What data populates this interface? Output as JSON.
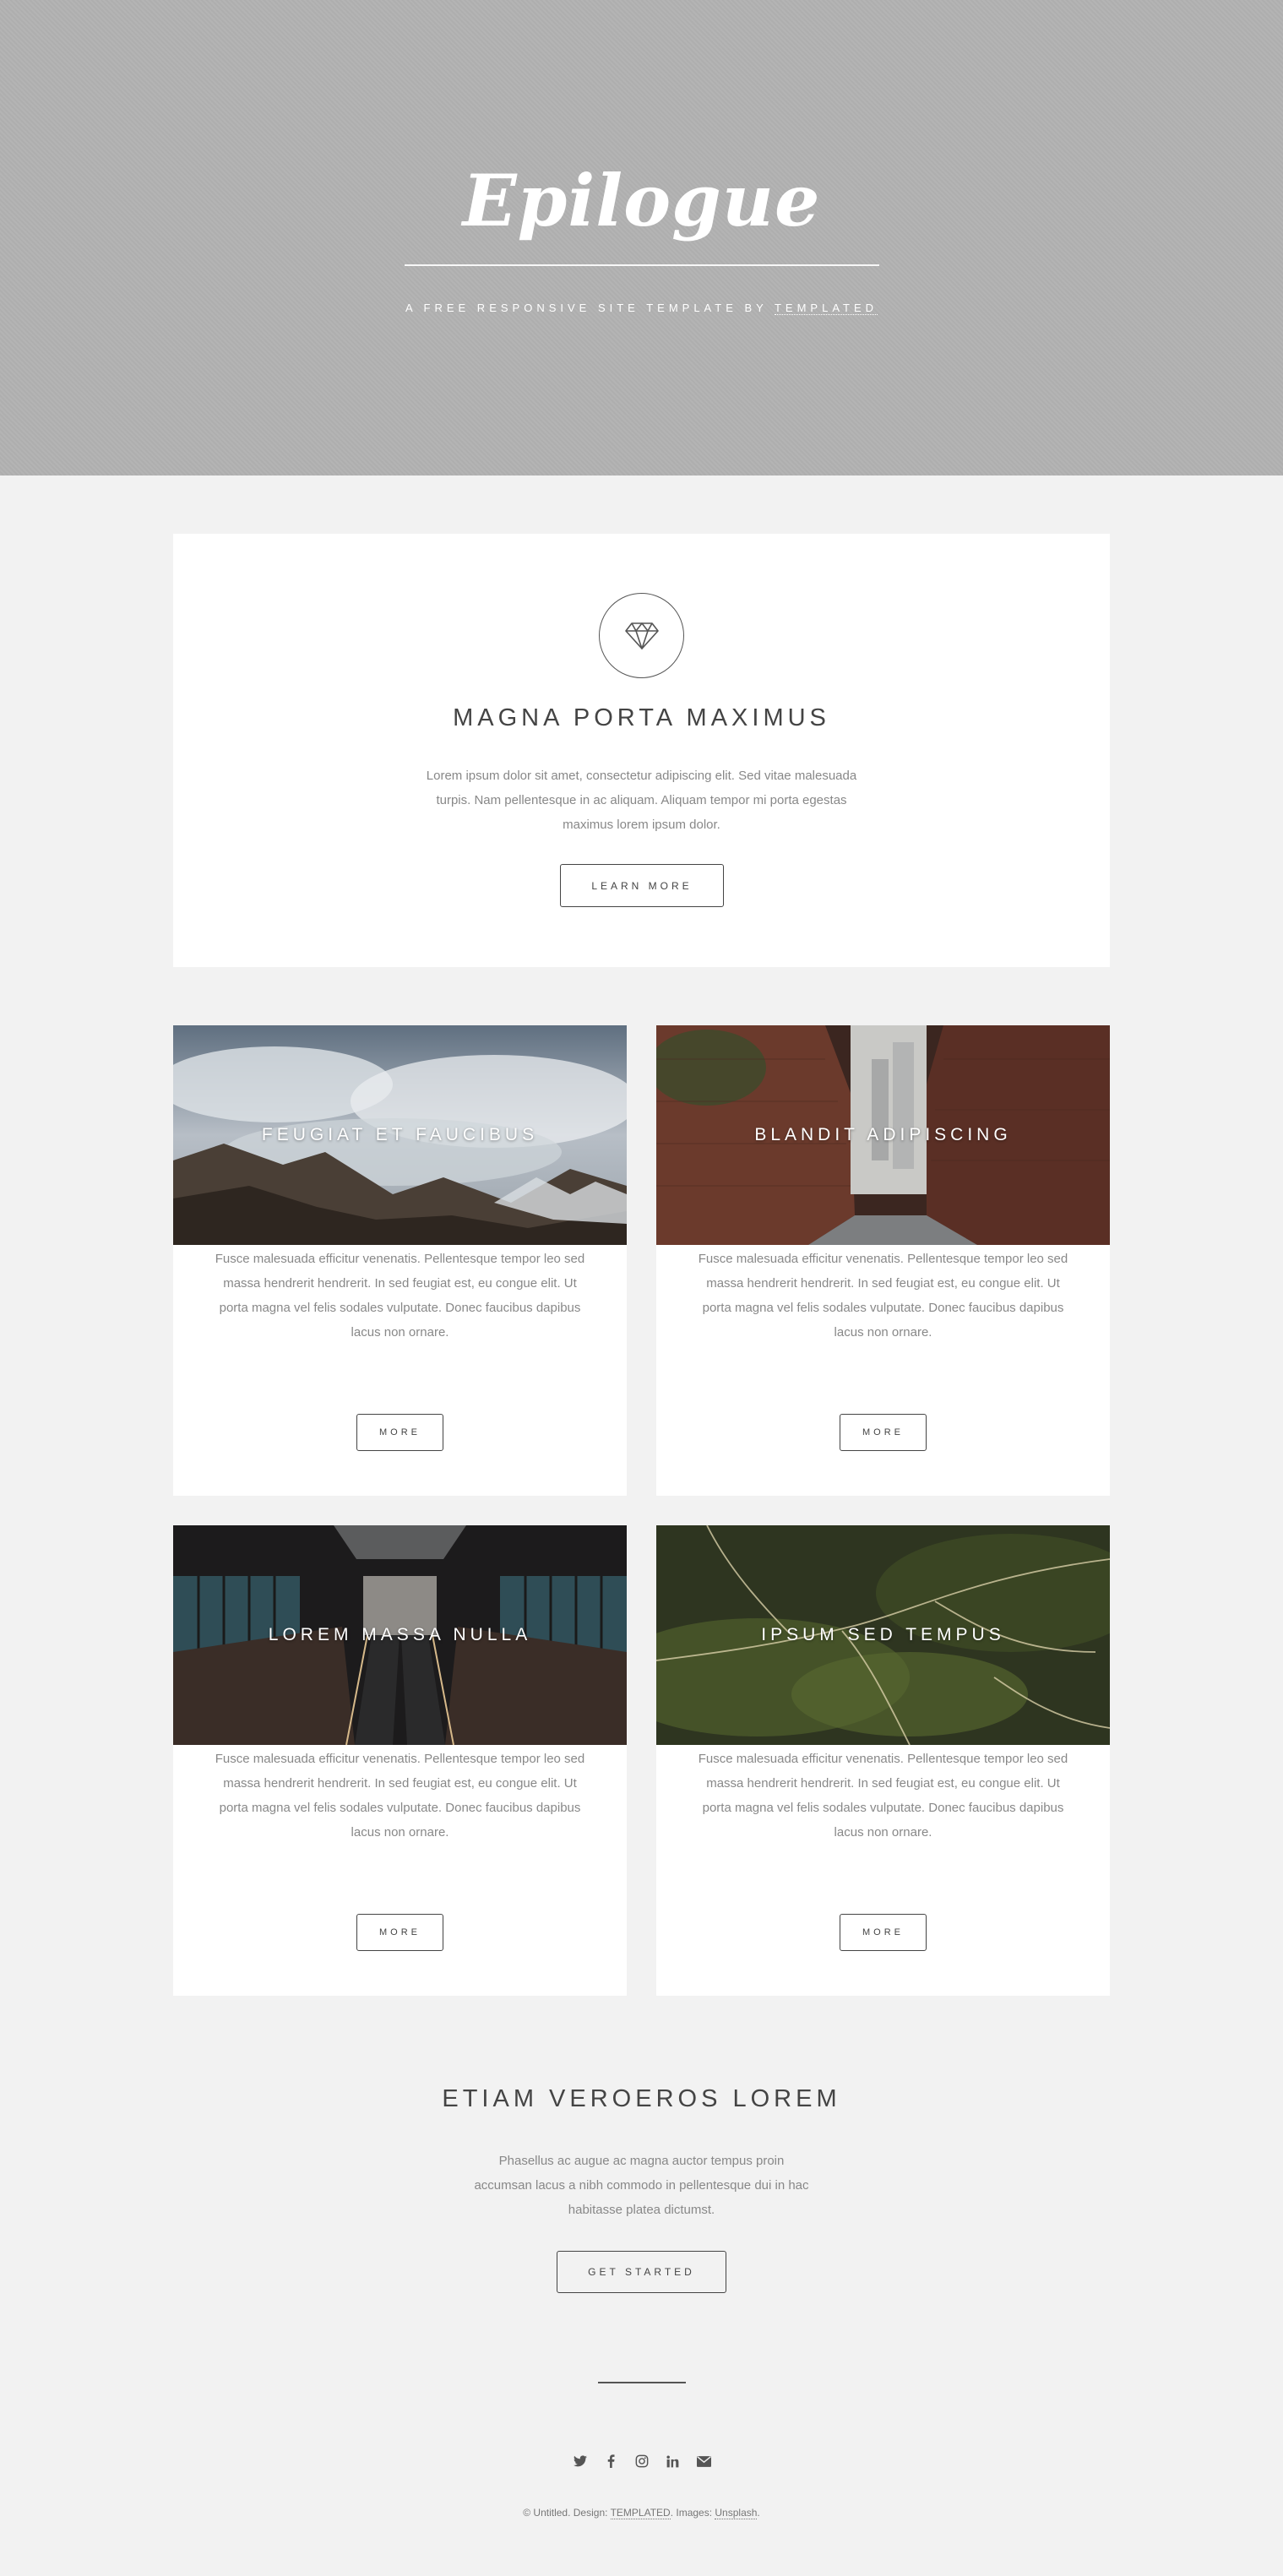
{
  "header": {
    "logo": "Epilogue",
    "tagline_prefix": "A free responsive site template by",
    "tagline_link": "TEMPLATED"
  },
  "intro": {
    "icon": "diamond-icon",
    "title": "Magna Porta Maximus",
    "text": "Lorem ipsum dolor sit amet, consectetur adipiscing elit. Sed vitae malesuada turpis. Nam pellentesque in ac aliquam. Aliquam tempor mi porta egestas maximus lorem ipsum dolor.",
    "button": "Learn More"
  },
  "tiles": [
    {
      "title": "Feugiat et Faucibus",
      "image": "mountain-clouds-image",
      "text": "Fusce malesuada efficitur venenatis. Pellentesque tempor leo sed massa hendrerit hendrerit. In sed feugiat est, eu congue elit. Ut porta magna vel felis sodales vulputate. Donec faucibus dapibus lacus non ornare.",
      "button": "More"
    },
    {
      "title": "Blandit Adipiscing",
      "image": "brick-alley-image",
      "text": "Fusce malesuada efficitur venenatis. Pellentesque tempor leo sed massa hendrerit hendrerit. In sed feugiat est, eu congue elit. Ut porta magna vel felis sodales vulputate. Donec faucibus dapibus lacus non ornare.",
      "button": "More"
    },
    {
      "title": "Lorem Massa Nulla",
      "image": "escalator-station-image",
      "text": "Fusce malesuada efficitur venenatis. Pellentesque tempor leo sed massa hendrerit hendrerit. In sed feugiat est, eu congue elit. Ut porta magna vel felis sodales vulputate. Donec faucibus dapibus lacus non ornare.",
      "button": "More"
    },
    {
      "title": "Ipsum Sed Tempus",
      "image": "aerial-terrain-image",
      "text": "Fusce malesuada efficitur venenatis. Pellentesque tempor leo sed massa hendrerit hendrerit. In sed feugiat est, eu congue elit. Ut porta magna vel felis sodales vulputate. Donec faucibus dapibus lacus non ornare.",
      "button": "More"
    }
  ],
  "cta": {
    "title": "Etiam Veroeros Lorem",
    "text": "Phasellus ac augue ac magna auctor tempus proin accumsan lacus a nibh commodo in pellentesque dui in hac habitasse platea dictumst.",
    "button": "Get Started"
  },
  "footer": {
    "social": [
      "twitter-icon",
      "facebook-icon",
      "instagram-icon",
      "linkedin-icon",
      "envelope-icon"
    ],
    "copy_prefix": "© Untitled. Design: ",
    "design_link": "TEMPLATED",
    "images_prefix": ". Images: ",
    "images_link": "Unsplash",
    "copy_suffix": "."
  },
  "colors": {
    "header_bg": "#b1b1b1",
    "page_bg": "#f2f2f2",
    "card_bg": "#ffffff",
    "text": "#444444",
    "muted": "#888888"
  }
}
